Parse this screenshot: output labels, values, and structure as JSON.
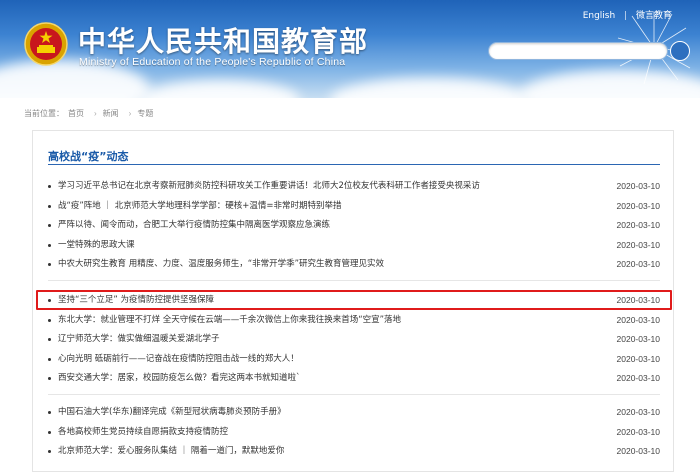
{
  "header": {
    "title": "中华人民共和国教育部",
    "subtitle": "Ministry of Education of the People's Republic of China",
    "links": [
      "English",
      "微言教育"
    ]
  },
  "breadcrumb": {
    "label": "当前位置：",
    "items": [
      "首页",
      "新闻",
      "专题"
    ]
  },
  "section": {
    "title": "高校战“疫”动态"
  },
  "groups": [
    [
      {
        "title": "学习习近平总书记在北京考察新冠肺炎防控科研攻关工作重要讲话！北师大2位校友代表科研工作者接受央视采访",
        "date": "2020-03-10"
      },
      {
        "title": "战“疫”阵地 ｜ 北京师范大学地理科学学部：硬核+温情=非常时期特别举措",
        "date": "2020-03-10"
      },
      {
        "title": "严阵以待、闻令而动，合肥工大举行疫情防控集中隔离医学观察应急演练",
        "date": "2020-03-10"
      },
      {
        "title": "一堂特殊的思政大课",
        "date": "2020-03-10"
      },
      {
        "title": "中农大研究生教育 用精度、力度、温度服务师生，“非常开学季”研究生教育管理见实效",
        "date": "2020-03-10"
      }
    ],
    [
      {
        "title": "坚持“三个立足” 为疫情防控提供坚强保障",
        "date": "2020-03-10"
      },
      {
        "title": "东北大学：就业管理不打烊 全天守候在云端——千余次微信上你来我往换来首场“空宣”落地",
        "date": "2020-03-10"
      },
      {
        "title": "辽宁师范大学：做实做细温暖关爱湖北学子",
        "date": "2020-03-10"
      },
      {
        "title": "心向光明 砥砺前行——记奋战在疫情防控阻击战一线的郑大人！",
        "date": "2020-03-10"
      },
      {
        "title": "  西安交通大学：居家，校园防疫怎么做？看完这两本书就知道啦`",
        "date": "2020-03-10"
      }
    ],
    [
      {
        "title": "中国石油大学(华东)翻译完成《新型冠状病毒肺炎预防手册》",
        "date": "2020-03-10"
      },
      {
        "title": "各地高校师生党员持续自愿捐款支持疫情防控",
        "date": "2020-03-10"
      },
      {
        "title": "北京师范大学：爱心服务队集结 ｜ 隔着一道门，默默地爱你",
        "date": "2020-03-10"
      }
    ]
  ]
}
